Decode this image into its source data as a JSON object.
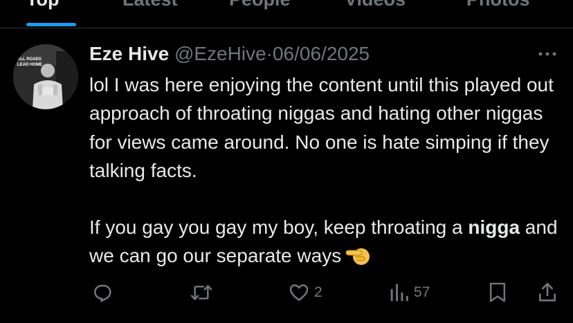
{
  "tabs": [
    {
      "label": "Top",
      "active": true
    },
    {
      "label": "Latest",
      "active": false
    },
    {
      "label": "People",
      "active": false
    },
    {
      "label": "Videos",
      "active": false
    },
    {
      "label": "Photos",
      "active": false
    }
  ],
  "avatar": {
    "caption_line1": "ALL ROADS",
    "caption_line2": "LEAD HOME"
  },
  "post": {
    "author_name": "Eze Hive",
    "handle": "@EzeHive",
    "separator": "·",
    "date": "06/06/2025",
    "paragraph1": "lol I was here enjoying the content until this played out approach of throating niggas and hating other niggas for views came around. No one is hate simping if they talking facts.",
    "paragraph2_before": "If you gay you gay my boy, keep throating a ",
    "paragraph2_bold": "nigga",
    "paragraph2_after": " and we can go our separate ways",
    "emoji": "backhand-index-pointing-left-emoji"
  },
  "actions": {
    "reply": {
      "icon": "reply-icon",
      "count": ""
    },
    "repost": {
      "icon": "repost-icon",
      "count": ""
    },
    "like": {
      "icon": "heart-icon",
      "count": "2"
    },
    "views": {
      "icon": "views-icon",
      "count": "57"
    },
    "bookmark": {
      "icon": "bookmark-icon"
    },
    "share": {
      "icon": "share-icon"
    }
  },
  "colors": {
    "background": "#000000",
    "text_primary": "#e7e9ea",
    "text_secondary": "#71767b",
    "accent": "#1d9bf0",
    "divider": "#2f3336"
  }
}
